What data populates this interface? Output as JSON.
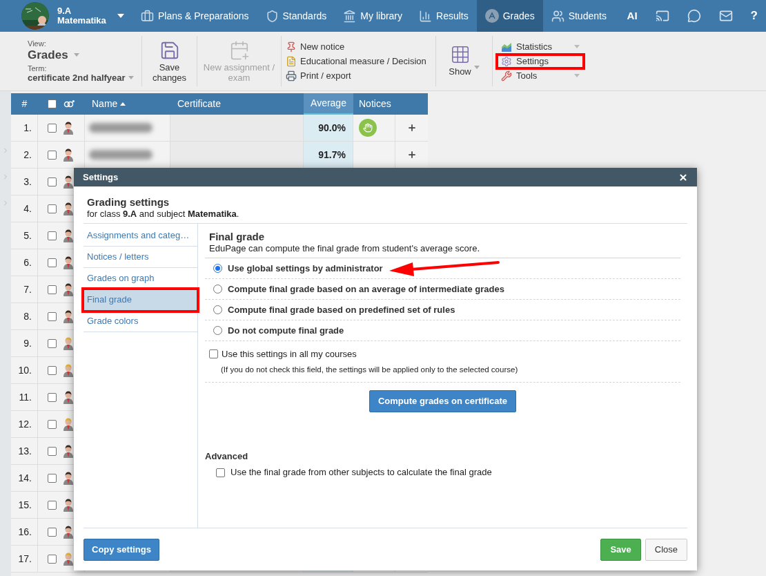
{
  "nav": {
    "class_name": "9.A",
    "subject": "Matematika",
    "items": [
      {
        "label": "Plans & Preparations",
        "selected": false
      },
      {
        "label": "Standards",
        "selected": false
      },
      {
        "label": "My library",
        "selected": false
      },
      {
        "label": "Results",
        "selected": false
      },
      {
        "label": "Grades",
        "selected": true
      },
      {
        "label": "Students",
        "selected": false
      }
    ],
    "ai_label": "AI",
    "help_label": "?"
  },
  "toolbar": {
    "view_label": "View:",
    "view_value": "Grades",
    "term_label": "Term:",
    "term_value": "certificate 2nd halfyear",
    "save_label": "Save changes",
    "new_assignment_label": "New assignment / exam",
    "new_assignment_disabled": true,
    "actions": [
      {
        "label": "New notice"
      },
      {
        "label": "Educational measure / Decision"
      },
      {
        "label": "Print / export"
      }
    ],
    "show_label": "Show",
    "menu": [
      {
        "label": "Statistics",
        "has_caret": true,
        "highlighted": false
      },
      {
        "label": "Settings",
        "has_caret": false,
        "highlighted": true
      },
      {
        "label": "Tools",
        "has_caret": true,
        "highlighted": false
      }
    ]
  },
  "table": {
    "all_checked": false,
    "columns": {
      "number": "#",
      "name": "Name",
      "certificate": "Certificate",
      "average": "Average",
      "notices": "Notices"
    },
    "rows": [
      {
        "number": "1.",
        "kind": "dark",
        "checked": false,
        "average": "90.0%",
        "has_notice": true
      },
      {
        "number": "2.",
        "kind": "dark",
        "checked": false,
        "average": "91.7%",
        "has_notice": false
      },
      {
        "number": "3.",
        "kind": "dark",
        "checked": false
      },
      {
        "number": "4.",
        "kind": "dark",
        "checked": false
      },
      {
        "number": "5.",
        "kind": "dark",
        "checked": false
      },
      {
        "number": "6.",
        "kind": "dark",
        "checked": false
      },
      {
        "number": "7.",
        "kind": "dark",
        "checked": false
      },
      {
        "number": "8.",
        "kind": "dark",
        "checked": false
      },
      {
        "number": "9.",
        "kind": "blond",
        "checked": false
      },
      {
        "number": "10.",
        "kind": "blond",
        "checked": false
      },
      {
        "number": "11.",
        "kind": "dark",
        "checked": false
      },
      {
        "number": "12.",
        "kind": "blond",
        "checked": false
      },
      {
        "number": "13.",
        "kind": "dark",
        "checked": false
      },
      {
        "number": "14.",
        "kind": "dark",
        "checked": false
      },
      {
        "number": "15.",
        "kind": "dark",
        "checked": false
      },
      {
        "number": "16.",
        "kind": "dark",
        "checked": false
      },
      {
        "number": "17.",
        "kind": "blond",
        "checked": false
      }
    ]
  },
  "dialog": {
    "title": "Settings",
    "heading": "Grading settings",
    "subheading": "for class **9.A** and subject **Matematika**.",
    "tabs": [
      {
        "label": "Assignments and categ…",
        "selected": false,
        "highlighted": false
      },
      {
        "label": "Notices / letters",
        "selected": false,
        "highlighted": false
      },
      {
        "label": "Grades on graph",
        "selected": false,
        "highlighted": false
      },
      {
        "label": "Final grade",
        "selected": true,
        "highlighted": true
      },
      {
        "label": "Grade colors",
        "selected": false,
        "highlighted": false
      }
    ],
    "section_title": "Final grade",
    "section_description": "EduPage can compute the final grade from student's average score.",
    "options": [
      {
        "label": "Use global settings by administrator",
        "selected": true,
        "pointed": true
      },
      {
        "label": "Compute final grade based on an average of intermediate grades",
        "selected": false,
        "pointed": false
      },
      {
        "label": "Compute final grade based on predefined set of rules",
        "selected": false,
        "pointed": false
      },
      {
        "label": "Do not compute final grade",
        "selected": false,
        "pointed": false
      }
    ],
    "all_courses": {
      "label": "Use this settings in all my courses",
      "checked": false,
      "note": "(If you do not check this field, the settings will be applied only to the selected course)"
    },
    "compute_button": "Compute grades on certificate",
    "advanced_title": "Advanced",
    "advanced_option": {
      "label": "Use the final grade from other subjects to calculate the final grade",
      "checked": false
    },
    "copy_button": "Copy settings",
    "save_button": "Save",
    "close_button": "Close"
  }
}
